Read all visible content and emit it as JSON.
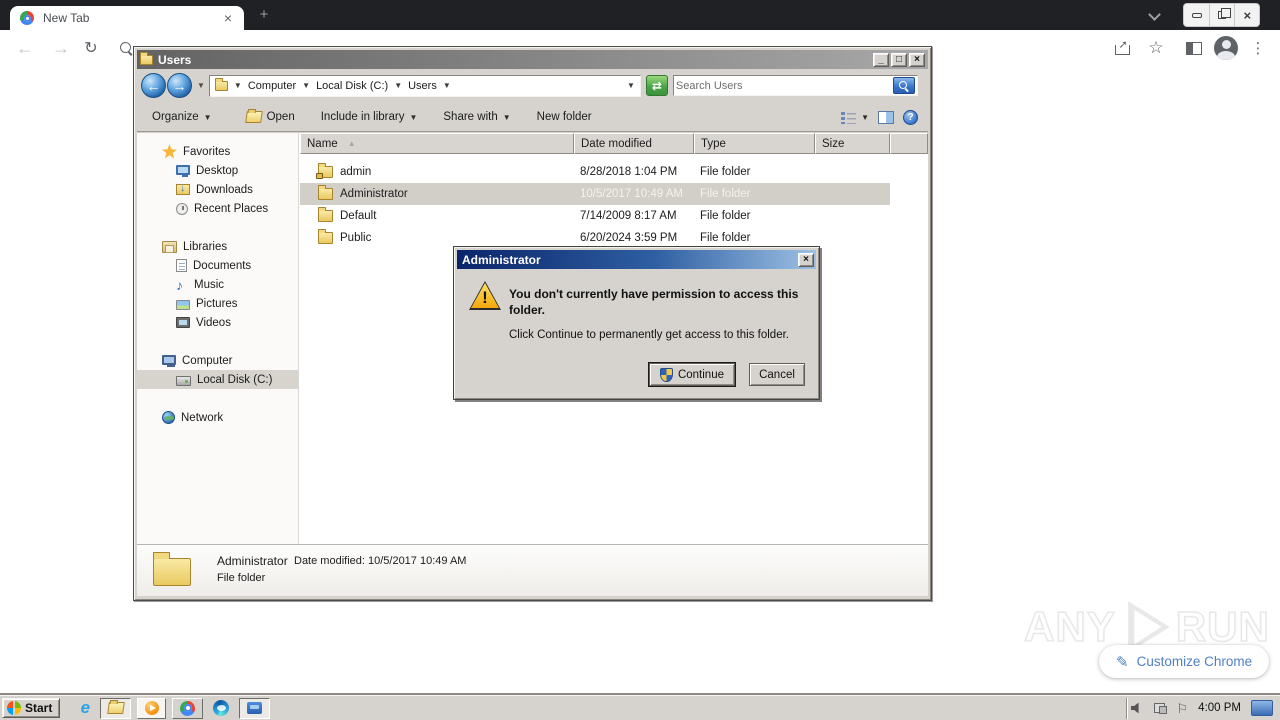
{
  "browser": {
    "tab_title": "New Tab",
    "customize_label": "Customize Chrome"
  },
  "explorer": {
    "title": "Users",
    "breadcrumb": [
      "Computer",
      "Local Disk (C:)",
      "Users"
    ],
    "search_placeholder": "Search Users",
    "toolbar": {
      "organize": "Organize",
      "open": "Open",
      "include_in_library": "Include in library",
      "share_with": "Share with",
      "new_folder": "New folder"
    },
    "sidebar": {
      "favorites": {
        "label": "Favorites",
        "items": [
          "Desktop",
          "Downloads",
          "Recent Places"
        ]
      },
      "libraries": {
        "label": "Libraries",
        "items": [
          "Documents",
          "Music",
          "Pictures",
          "Videos"
        ]
      },
      "computer": {
        "label": "Computer",
        "items": [
          "Local Disk (C:)"
        ]
      },
      "network": {
        "label": "Network"
      }
    },
    "list": {
      "columns": [
        "Name",
        "Date modified",
        "Type",
        "Size"
      ],
      "rows": [
        {
          "name": "admin",
          "date": "8/28/2018 1:04 PM",
          "type": "File folder",
          "size": ""
        },
        {
          "name": "Administrator",
          "date": "10/5/2017 10:49 AM",
          "type": "File folder",
          "size": ""
        },
        {
          "name": "Default",
          "date": "7/14/2009 8:17 AM",
          "type": "File folder",
          "size": ""
        },
        {
          "name": "Public",
          "date": "6/20/2024 3:59 PM",
          "type": "File folder",
          "size": ""
        }
      ]
    },
    "details": {
      "name": "Administrator",
      "date_label": "Date modified: 10/5/2017 10:49 AM",
      "type": "File folder"
    }
  },
  "dialog": {
    "title": "Administrator",
    "heading": "You don't currently have permission to access this folder.",
    "body": "Click Continue to permanently get access to this folder.",
    "continue_label": "Continue",
    "cancel_label": "Cancel"
  },
  "taskbar": {
    "start_label": "Start",
    "time": "4:00 PM"
  },
  "watermark": {
    "left": "ANY",
    "right": "RUN"
  },
  "colors": {
    "classic_face": "#d6d3ce",
    "dialog_titlebar": "#0a246a",
    "selection": "#d2cfc9",
    "chrome_dark_strip": "#1f2125"
  }
}
